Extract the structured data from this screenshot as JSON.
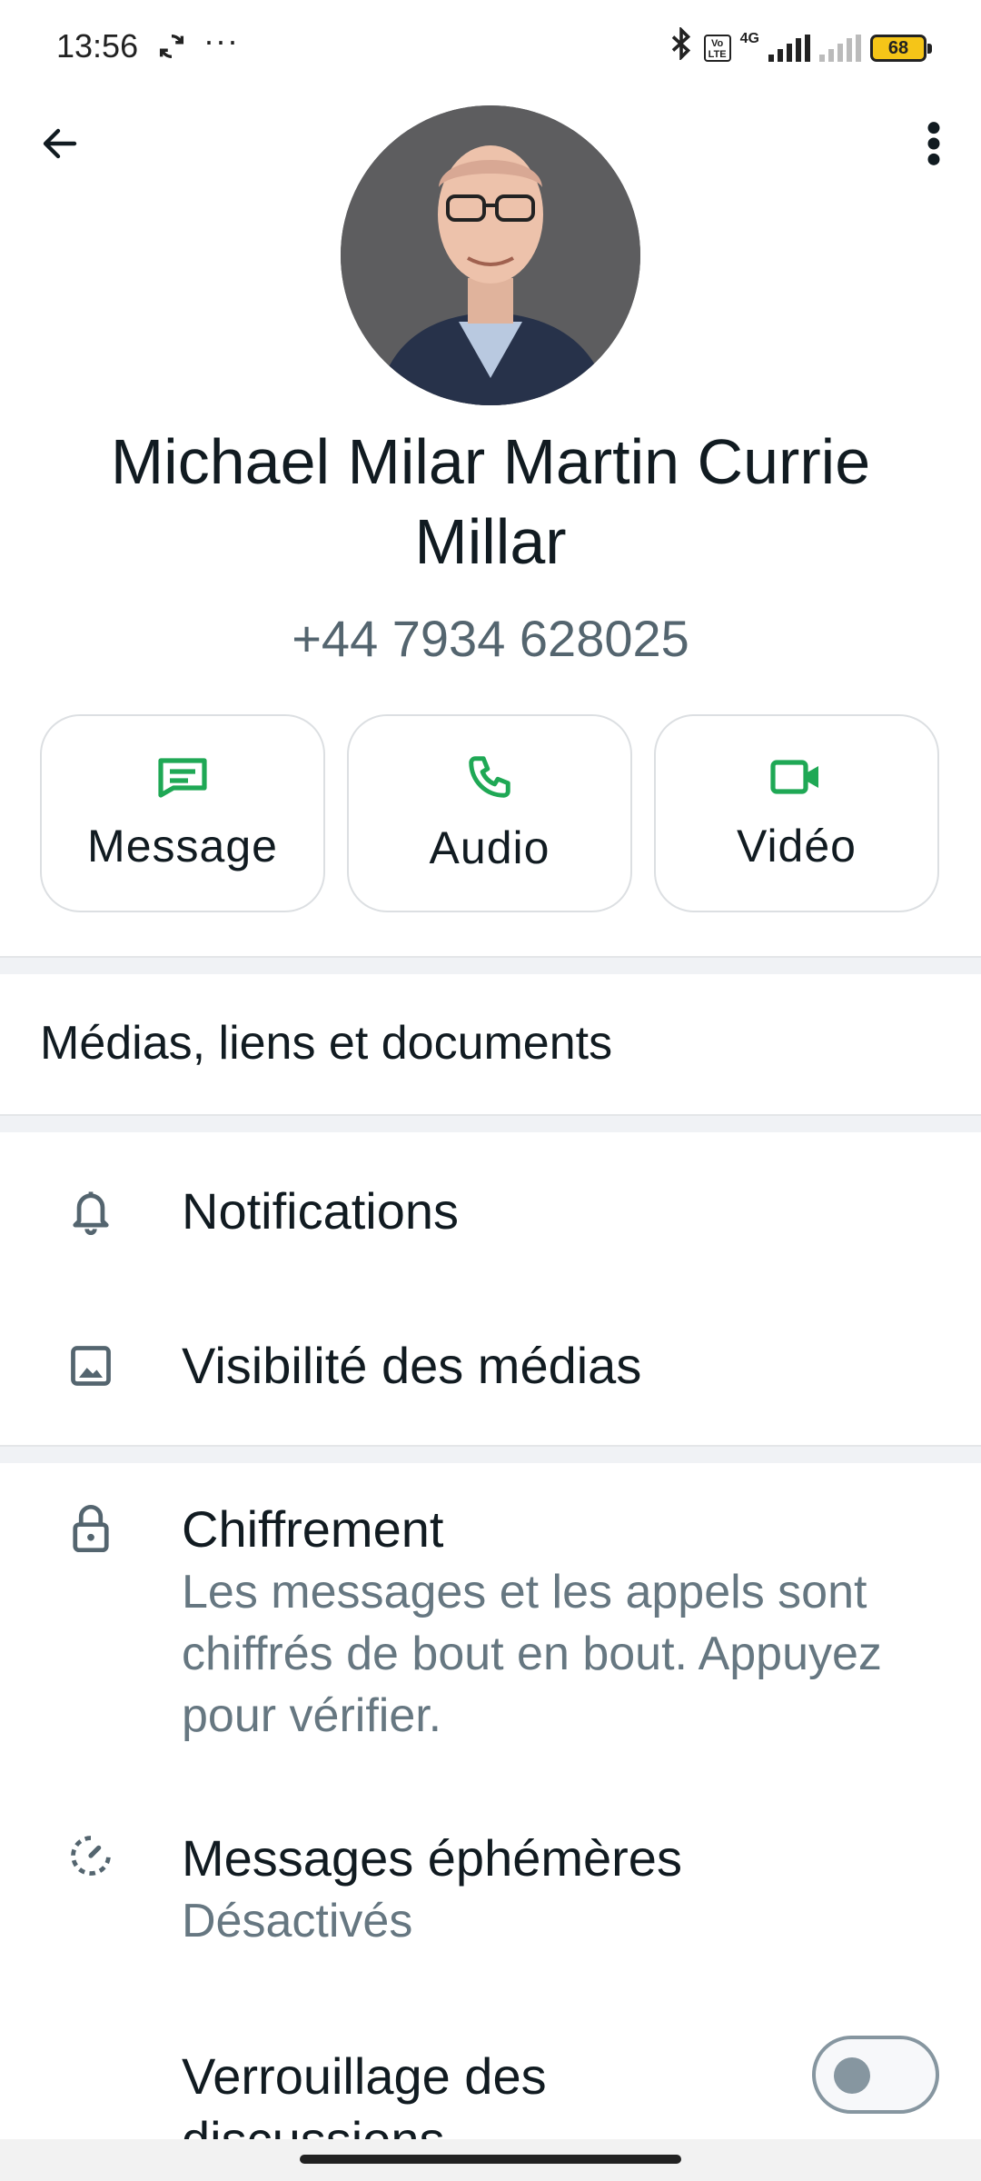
{
  "status_bar": {
    "time": "13:56",
    "more": "···",
    "network": "4G",
    "volte": "Vo LTE",
    "battery": "68"
  },
  "contact": {
    "name": "Michael Milar Martin Currie Millar",
    "phone": "+44 7934 628025"
  },
  "actions": [
    {
      "label": "Message",
      "icon": "message-icon"
    },
    {
      "label": "Audio",
      "icon": "phone-icon"
    },
    {
      "label": "Vidéo",
      "icon": "video-icon"
    }
  ],
  "sections": {
    "media": "Médias, liens et documents",
    "notifications": "Notifications",
    "media_visibility": "Visibilité des médias",
    "encryption": {
      "title": "Chiffrement",
      "subtitle": "Les messages et les appels sont chiffrés de bout en bout. Appuyez pour vérifier."
    },
    "disappearing": {
      "title": "Messages éphémères",
      "subtitle": "Désactivés"
    },
    "chat_lock": {
      "title": "Verrouillage des discussions",
      "enabled": false
    }
  },
  "colors": {
    "accent": "#1fa855",
    "icon_gray": "#54656f",
    "text_primary": "#111b21",
    "text_secondary": "#667781"
  }
}
